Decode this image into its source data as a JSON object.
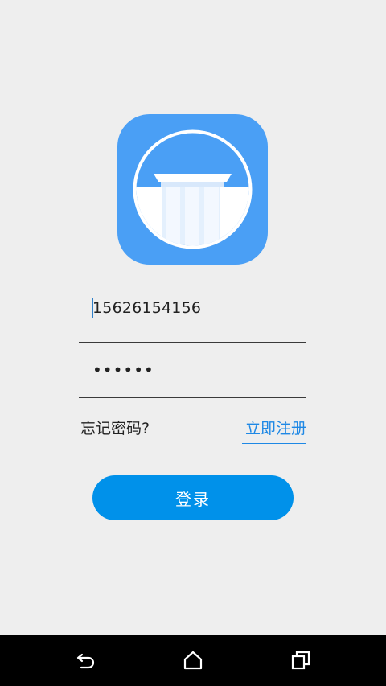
{
  "app": {
    "logo_icon": "pillar-gate-icon",
    "colors": {
      "logo_bg": "#4a9ff5",
      "accent": "#1e88e5",
      "button": "#0091ea",
      "background": "#eeeeee"
    }
  },
  "login_form": {
    "phone_value": "15626154156",
    "password_masked": "••••••",
    "forgot_password_label": "忘记密码?",
    "register_label": "立即注册",
    "login_button_label": "登录"
  },
  "nav_bar": {
    "back_icon": "back-icon",
    "home_icon": "home-icon",
    "recents_icon": "recents-icon"
  }
}
